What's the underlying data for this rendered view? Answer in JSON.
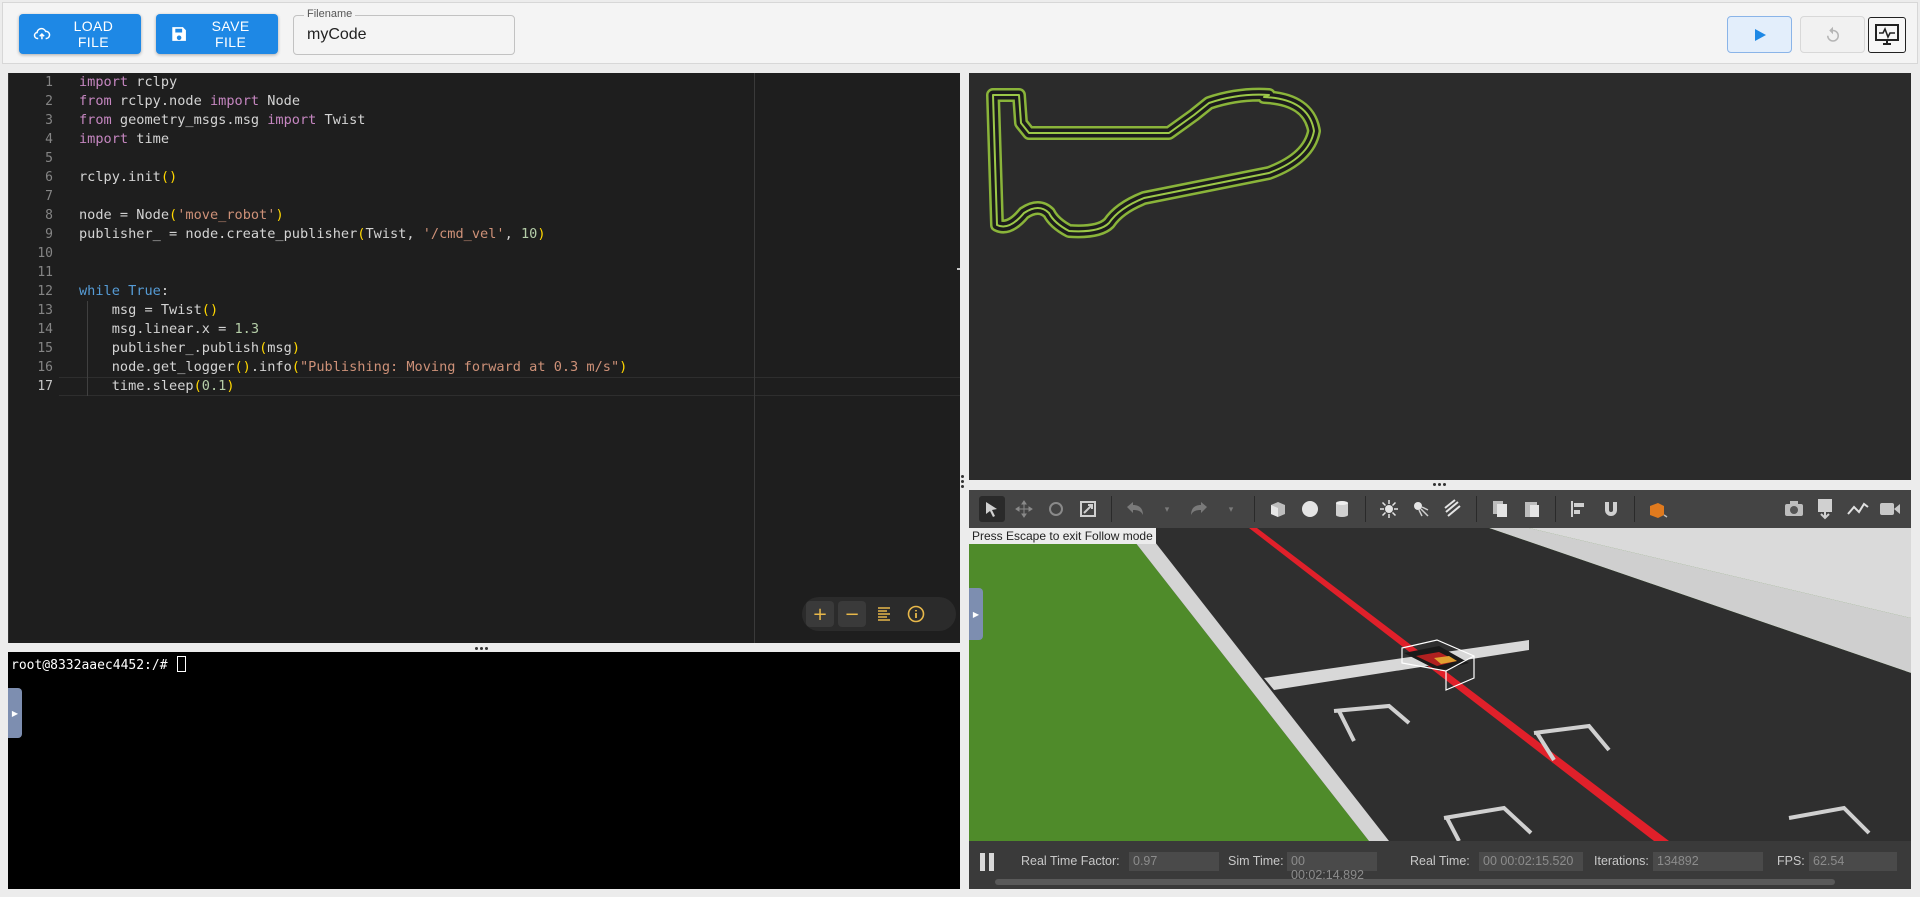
{
  "toolbar": {
    "load_label": "LOAD FILE",
    "save_label": "SAVE FILE",
    "filename_label": "Filename",
    "filename_value": "myCode"
  },
  "colors": {
    "primary": "#1e88e5",
    "editor_bg": "#1e1e1e",
    "track_green": "#8ab43a",
    "track_line_red": "#e0202a"
  },
  "editor": {
    "line_numbers": [
      "1",
      "2",
      "3",
      "4",
      "5",
      "6",
      "7",
      "8",
      "9",
      "10",
      "11",
      "12",
      "13",
      "14",
      "15",
      "16",
      "17"
    ],
    "current_line": "17",
    "code": {
      "l1": {
        "kw": "import",
        "rest": " rclpy"
      },
      "l2": {
        "kw1": "from",
        "mid": " rclpy.node ",
        "kw2": "import",
        "rest": " Node"
      },
      "l3": {
        "kw1": "from",
        "mid": " geometry_msgs.msg ",
        "kw2": "import",
        "rest": " Twist"
      },
      "l4": {
        "kw": "import",
        "rest": " time"
      },
      "l6": {
        "a": "rclpy.init",
        "b": "()"
      },
      "l8": {
        "a": "node = Node",
        "p1": "(",
        "s": "'move_robot'",
        "p2": ")"
      },
      "l9": {
        "a": "publisher_ = node.create_publisher",
        "p1": "(",
        "b": "Twist, ",
        "s": "'/cmd_vel'",
        "c": ", ",
        "n": "10",
        "p2": ")"
      },
      "l12": {
        "kw": "while",
        "sp": " ",
        "kw2": "True",
        "c": ":"
      },
      "l13": {
        "a": "    msg = Twist",
        "p": "()"
      },
      "l14": {
        "a": "    msg.linear.x = ",
        "n": "1.3"
      },
      "l15": {
        "a": "    publisher_.publish",
        "p1": "(",
        "b": "msg",
        "p2": ")"
      },
      "l16": {
        "a": "    node.get_logger",
        "p0": "()",
        "b": ".info",
        "p1": "(",
        "s": "\"Publishing: Moving forward at 0.3 m/s\"",
        "p2": ")"
      },
      "l17": {
        "a": "    time.sleep",
        "p1": "(",
        "n": "0.1",
        "p2": ")"
      }
    }
  },
  "terminal": {
    "prompt": "root@8332aaec4452:/# "
  },
  "gazebo": {
    "hint": "Press Escape to exit Follow mode",
    "status": {
      "rtf_label": "Real Time Factor:",
      "rtf_value": "0.97",
      "sim_label": "Sim Time:",
      "sim_value": "00 00:02:14.892",
      "real_label": "Real Time:",
      "real_value": "00 00:02:15.520",
      "iter_label": "Iterations:",
      "iter_value": "134892",
      "fps_label": "FPS:",
      "fps_value": "62.54"
    },
    "tools": [
      "select-icon",
      "translate-icon",
      "rotate-icon",
      "scale-icon",
      "undo-icon",
      "redo-icon",
      "box-icon",
      "sphere-icon",
      "cylinder-icon",
      "point-light-icon",
      "spot-light-icon",
      "directional-light-icon",
      "copy-icon",
      "paste-icon",
      "align-icon",
      "magnet-icon",
      "change-view-icon",
      "screenshot-icon",
      "log-icon",
      "plot-icon",
      "record-icon"
    ]
  }
}
